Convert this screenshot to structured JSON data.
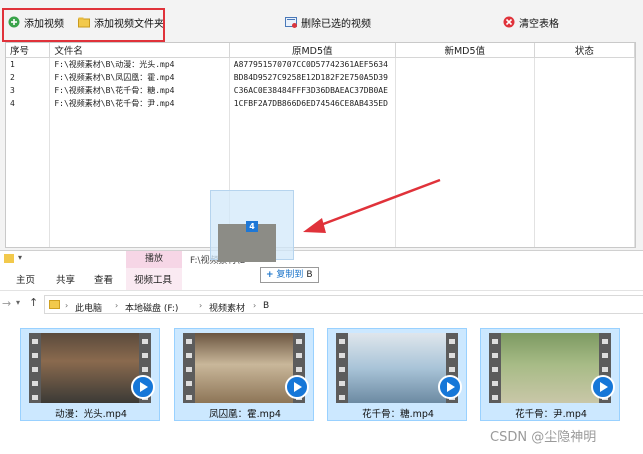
{
  "toolbar": {
    "add_video": "添加视频",
    "add_folder": "添加视频文件夹",
    "delete_selected": "删除已选的视频",
    "clear_table": "清空表格"
  },
  "table": {
    "headers": [
      "序号",
      "文件名",
      "原MD5值",
      "新MD5值",
      "状态"
    ],
    "rows": [
      [
        "1",
        "F:\\视频素材\\B\\动漫：光头.mp4",
        "A877951570707CC0D57742361AEF5634",
        "",
        ""
      ],
      [
        "2",
        "F:\\视频素材\\B\\凤囚凰：霍.mp4",
        "BD84D9527C9258E12D182F2E750A5D39",
        "",
        ""
      ],
      [
        "3",
        "F:\\视频素材\\B\\花千骨：糖.mp4",
        "C36AC0E38484FFF3D36DBAEAC37DB0AE",
        "",
        ""
      ],
      [
        "4",
        "F:\\视频素材\\B\\花千骨：尹.mp4",
        "1CFBF2A7DB866D6ED74546CE8AB435ED",
        "",
        ""
      ]
    ]
  },
  "drag": {
    "count": "4",
    "tip_action": "复制到",
    "tip_target": "B"
  },
  "explorer": {
    "context_tab": "播放",
    "title_path": "F:\\视频素材\\B",
    "tabs": [
      "主页",
      "共享",
      "查看",
      "视频工具"
    ],
    "breadcrumb": [
      "此电脑",
      "本地磁盘 (F:)",
      "视频素材",
      "B"
    ],
    "files": [
      {
        "name": "动漫：光头.mp4"
      },
      {
        "name": "凤囚凰：霍.mp4"
      },
      {
        "name": "花千骨：糖.mp4"
      },
      {
        "name": "花千骨：尹.mp4"
      }
    ]
  },
  "watermark": "CSDN @尘隐神明",
  "colors": {
    "highlight": "#e0323a",
    "selection": "#cce8ff",
    "accent": "#1677d8"
  }
}
